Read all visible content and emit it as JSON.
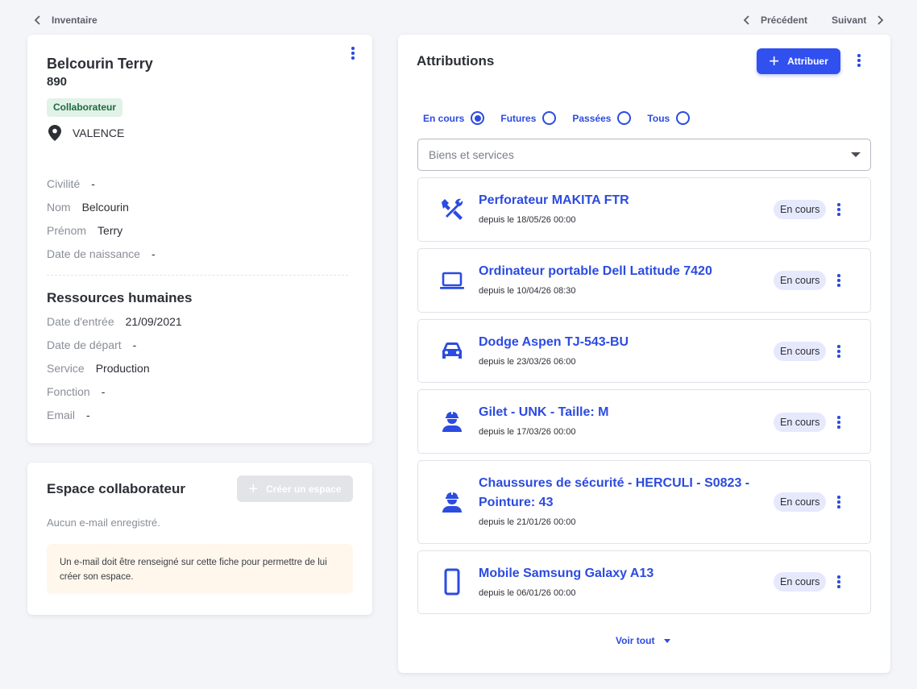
{
  "nav": {
    "back_label": "Inventaire",
    "prev_label": "Précédent",
    "next_label": "Suivant"
  },
  "profile": {
    "name": "Belcourin Terry",
    "number": "890",
    "role_badge": "Collaborateur",
    "location": "VALENCE",
    "identity_fields": [
      {
        "label": "Civilité",
        "value": "-"
      },
      {
        "label": "Nom",
        "value": "Belcourin"
      },
      {
        "label": "Prénom",
        "value": "Terry"
      },
      {
        "label": "Date de naissance",
        "value": "-"
      }
    ],
    "hr_title": "Ressources humaines",
    "hr_fields": [
      {
        "label": "Date d'entrée",
        "value": "21/09/2021"
      },
      {
        "label": "Date de départ",
        "value": "-"
      },
      {
        "label": "Service",
        "value": "Production"
      },
      {
        "label": "Fonction",
        "value": "-"
      },
      {
        "label": "Email",
        "value": "-"
      }
    ]
  },
  "espace": {
    "title": "Espace collaborateur",
    "create_label": "Créer un espace",
    "empty_text": "Aucun e-mail enregistré.",
    "warning": "Un e-mail doit être renseigné sur cette fiche pour permettre de lui créer son espace."
  },
  "attributions": {
    "title": "Attributions",
    "assign_label": "Attribuer",
    "filters": [
      {
        "label": "En cours",
        "selected": true
      },
      {
        "label": "Futures",
        "selected": false
      },
      {
        "label": "Passées",
        "selected": false
      },
      {
        "label": "Tous",
        "selected": false
      }
    ],
    "select_placeholder": "Biens et services",
    "items": [
      {
        "icon": "tools-icon",
        "title": "Perforateur MAKITA FTR",
        "since": "depuis le 18/05/26 00:00",
        "status": "En cours"
      },
      {
        "icon": "laptop-icon",
        "title": "Ordinateur portable Dell Latitude 7420",
        "since": "depuis le 10/04/26 08:30",
        "status": "En cours"
      },
      {
        "icon": "car-icon",
        "title": "Dodge Aspen TJ-543-BU",
        "since": "depuis le 23/03/26 06:00",
        "status": "En cours"
      },
      {
        "icon": "worker-icon",
        "title": "Gilet - UNK - Taille: M",
        "since": "depuis le 17/03/26 00:00",
        "status": "En cours"
      },
      {
        "icon": "worker-icon",
        "title": "Chaussures de sécurité - HERCULI - S0823 - Pointure: 43",
        "since": "depuis le 21/01/26 00:00",
        "status": "En cours"
      },
      {
        "icon": "smartphone-icon",
        "title": "Mobile Samsung Galaxy A13",
        "since": "depuis le 06/01/26 00:00",
        "status": "En cours"
      }
    ],
    "see_all_label": "Voir tout"
  },
  "colors": {
    "accent": "#2c4be0",
    "primary_button": "#3050f0",
    "badge_green_bg": "#e1f2e8",
    "status_bg": "#e6e9fb",
    "warning_bg": "#fff7ec"
  }
}
